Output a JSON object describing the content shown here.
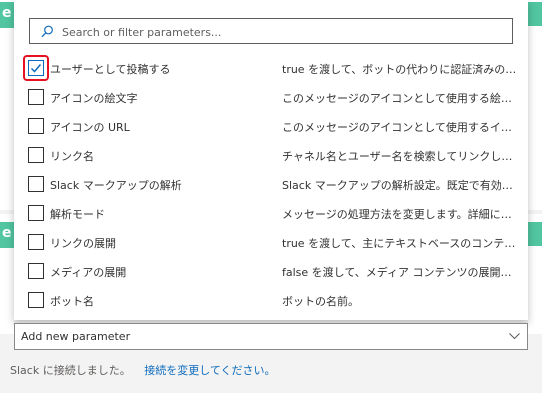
{
  "search": {
    "placeholder": "Search or filter parameters..."
  },
  "parameters": [
    {
      "name": "ユーザーとして投稿する",
      "description": "true を渡して、ボットの代わりに認証済みのユーザーと...",
      "checked": true
    },
    {
      "name": "アイコンの絵文字",
      "description": "このメッセージのアイコンとして使用する絵文字。",
      "checked": false
    },
    {
      "name": "アイコンの URL",
      "description": "このメッセージのアイコンとして使用するイメージへの UR...",
      "checked": false
    },
    {
      "name": "リンク名",
      "description": "チャネル名とユーザー名を検索してリンクします。",
      "checked": false
    },
    {
      "name": "Slack マークアップの解析",
      "description": "Slack マークアップの解析設定。既定で有効です。",
      "checked": false
    },
    {
      "name": "解析モード",
      "description": "メッセージの処理方法を変更します。詳細については...",
      "checked": false
    },
    {
      "name": "リンクの展開",
      "description": "true を渡して、主にテキストベースのコンテンツの展開...",
      "checked": false
    },
    {
      "name": "メディアの展開",
      "description": "false を渡して、メディア コンテンツの展開を無効にしま...",
      "checked": false
    },
    {
      "name": "ボット名",
      "description": "ボットの名前。",
      "checked": false
    }
  ],
  "add_parameter": {
    "label": "Add new parameter"
  },
  "footer": {
    "status": "Slack に接続しました。",
    "link": "接続を変更してください。"
  },
  "colors": {
    "accent": "#0f6cbd",
    "highlight": "#e81123",
    "slack_tile": "#51c6a0"
  }
}
